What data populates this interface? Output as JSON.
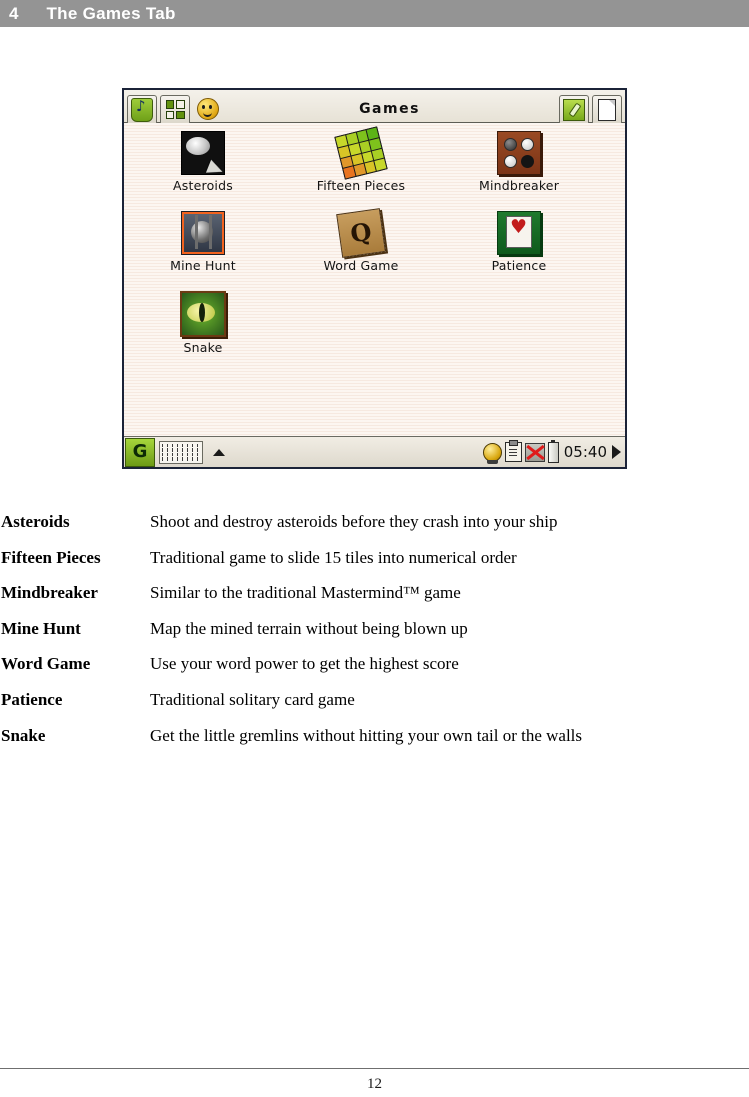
{
  "page": {
    "chapter_number": "4",
    "chapter_title": "The Games Tab",
    "page_number": "12"
  },
  "device": {
    "toolbar": {
      "tabs": [
        {
          "name": "music-tab",
          "icon": "music-note-icon",
          "active": false
        },
        {
          "name": "apps-tab",
          "icon": "grid-puzzle-icon",
          "active": false
        },
        {
          "name": "games-tab",
          "icon": "smiley-face-icon",
          "active": true
        }
      ],
      "title": "Games",
      "right_buttons": [
        {
          "name": "settings-button",
          "icon": "wrench-icon"
        },
        {
          "name": "new-document-button",
          "icon": "document-icon"
        }
      ]
    },
    "apps": [
      [
        {
          "label": "Asteroids",
          "icon": "asteroids-icon"
        },
        {
          "label": "Fifteen Pieces",
          "icon": "fifteen-pieces-icon"
        },
        {
          "label": "Mindbreaker",
          "icon": "mindbreaker-icon"
        }
      ],
      [
        {
          "label": "Mine Hunt",
          "icon": "mine-hunt-icon"
        },
        {
          "label": "Word Game",
          "icon": "word-game-icon"
        },
        {
          "label": "Patience",
          "icon": "patience-icon"
        }
      ],
      [
        {
          "label": "Snake",
          "icon": "snake-icon"
        }
      ]
    ],
    "word_game_tile_letter": "Q",
    "fifteen_pieces_tile_colors": [
      "#c7d82a",
      "#a9cf24",
      "#7ec21c",
      "#5cb317",
      "#d8c426",
      "#c7d82a",
      "#a9cf24",
      "#7ec21c",
      "#e0972a",
      "#d8c426",
      "#c7d82a",
      "#a9cf24",
      "#e8731f",
      "#e0972a",
      "#d8c426",
      "#c7d82a"
    ],
    "taskbar": {
      "start_button_label": "G",
      "keyboard_button": "keyboard-icon",
      "expand_arrow": "up-arrow-icon",
      "tray": {
        "globe_icon": "globe-icon",
        "clipboard_icon": "clipboard-icon",
        "network_off_icon": "network-disconnected-icon",
        "battery_icon": "battery-icon",
        "time": "05:40",
        "next_arrow": "right-arrow-icon"
      }
    }
  },
  "descriptions": [
    {
      "term": "Asteroids",
      "text": "Shoot and destroy asteroids before they crash into your ship"
    },
    {
      "term": "Fifteen Pieces",
      "text": "Traditional game to slide 15 tiles into numerical order"
    },
    {
      "term": "Mindbreaker",
      "text": "Similar to the traditional Mastermind™ game"
    },
    {
      "term": "Mine Hunt",
      "text": "Map the mined terrain without being blown up"
    },
    {
      "term": "Word Game",
      "text": "Use your word power to get the highest score"
    },
    {
      "term": "Patience",
      "text": "Traditional solitary card game"
    },
    {
      "term": "Snake",
      "text": "Get the little gremlins without hitting your own tail or the walls"
    }
  ],
  "colors": {
    "header_band": "#949494",
    "device_border": "#1b2338",
    "desktop_background": "#fcf6f1",
    "accent_green": "#7ea81a"
  }
}
